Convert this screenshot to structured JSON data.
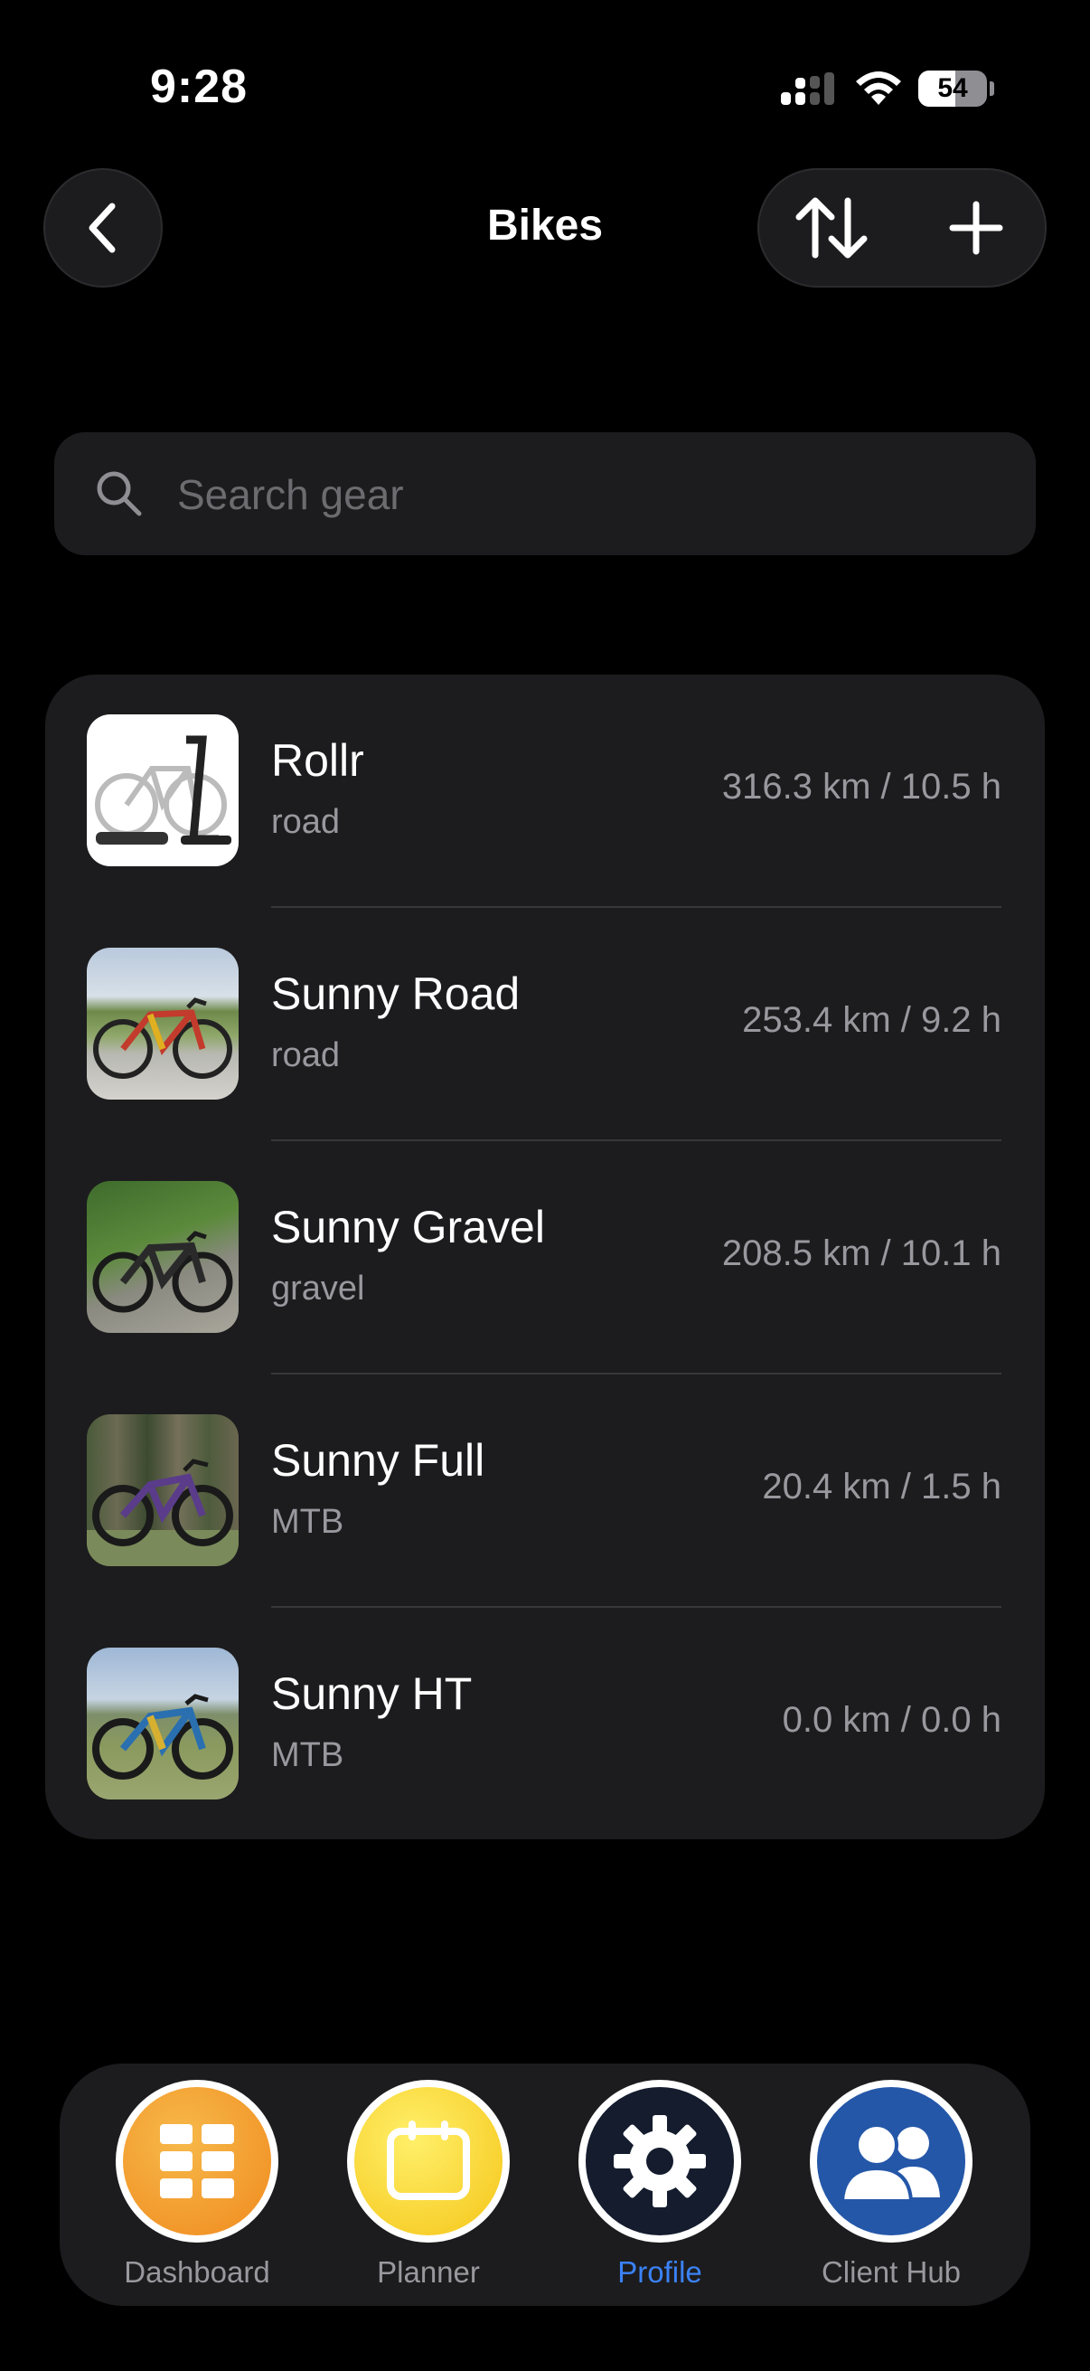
{
  "status_bar": {
    "time": "9:28",
    "battery": "54",
    "battery_level": 0.54
  },
  "header": {
    "title": "Bikes"
  },
  "search": {
    "placeholder": "Search gear",
    "value": ""
  },
  "bikes": [
    {
      "name": "Rollr",
      "type": "road",
      "stats": "316.3 km / 10.5 h",
      "photo": "trainer"
    },
    {
      "name": "Sunny Road",
      "type": "road",
      "stats": "253.4 km / 9.2 h",
      "photo": "road"
    },
    {
      "name": "Sunny Gravel",
      "type": "gravel",
      "stats": "208.5 km / 10.1 h",
      "photo": "gravel"
    },
    {
      "name": "Sunny Full",
      "type": "MTB",
      "stats": "20.4 km / 1.5 h",
      "photo": "mtb-forest"
    },
    {
      "name": "Sunny HT",
      "type": "MTB",
      "stats": "0.0 km / 0.0 h",
      "photo": "mtb-field"
    }
  ],
  "tabbar": {
    "items": [
      {
        "label": "Dashboard",
        "icon": "grid-icon"
      },
      {
        "label": "Planner",
        "icon": "calendar-icon"
      },
      {
        "label": "Profile",
        "icon": "gear-icon",
        "active": true
      },
      {
        "label": "Client Hub",
        "icon": "people-icon"
      }
    ]
  },
  "colors": {
    "accent": "#3b82f6",
    "background": "#000000",
    "card": "#1c1c1e"
  }
}
